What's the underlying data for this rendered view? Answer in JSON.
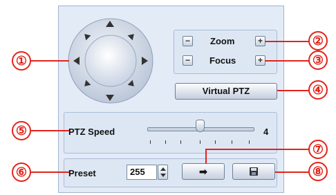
{
  "zoom": {
    "label": "Zoom",
    "minus": "−",
    "plus": "+"
  },
  "focus": {
    "label": "Focus",
    "minus": "−",
    "plus": "+"
  },
  "virtual_ptz": {
    "label": "Virtual PTZ"
  },
  "speed": {
    "label": "PTZ Speed",
    "value": "4",
    "level_fraction": 0.5
  },
  "preset": {
    "label": "Preset",
    "value": "255",
    "go_icon": "➡",
    "save_icon": "floppy-disk-icon"
  },
  "callouts": [
    "①",
    "②",
    "③",
    "④",
    "⑤",
    "⑥",
    "⑦",
    "⑧"
  ]
}
